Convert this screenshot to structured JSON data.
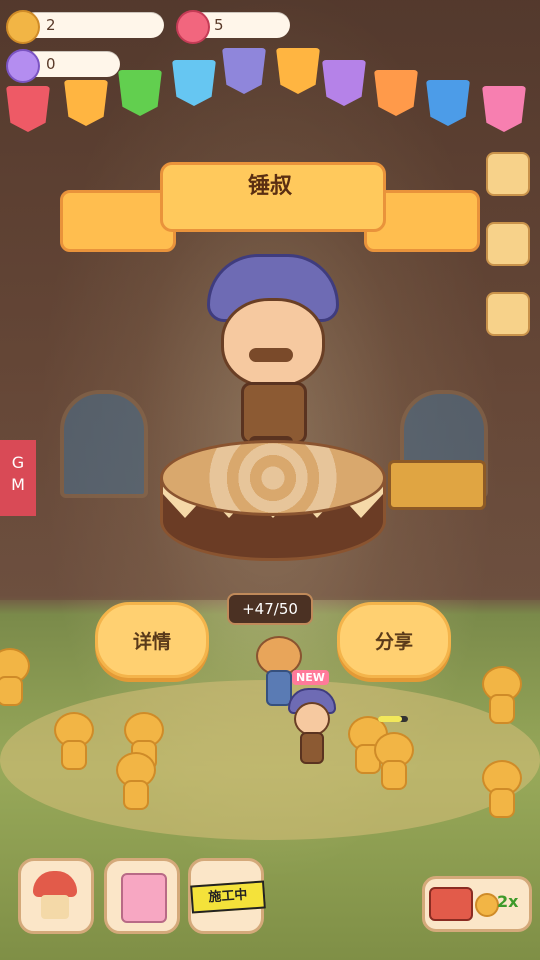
{
  "hud": {
    "cookie_count": "2",
    "heart_count": "5",
    "candy_count": "0"
  },
  "character": {
    "name": "锤叔"
  },
  "actions": {
    "details_label": "详情",
    "share_label": "分享"
  },
  "capacity": {
    "text": "47/50",
    "prefix": "+"
  },
  "npc_badge": "NEW",
  "gm_label": "G\nM",
  "bottom_bar": {
    "construction_label": "施工中",
    "speed_label": "2x"
  },
  "colors": {
    "accent": "#ffd071",
    "ribbon": "#ffc95c",
    "gm": "#d94a56"
  }
}
